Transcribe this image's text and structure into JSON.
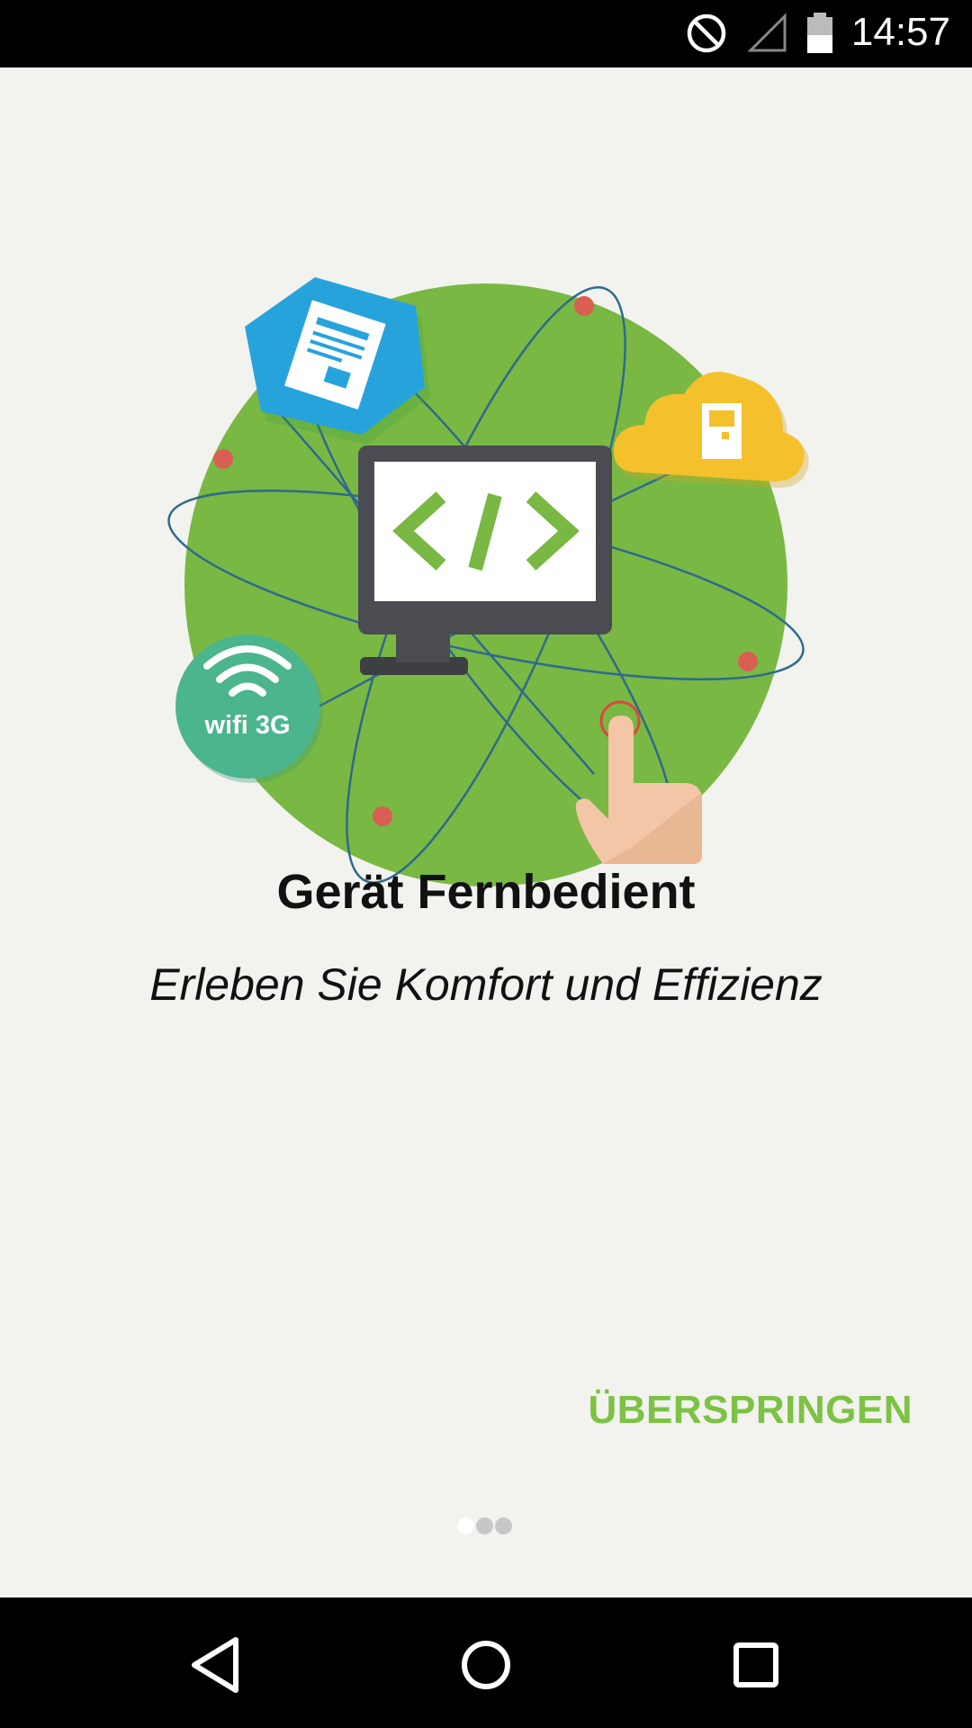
{
  "status_bar": {
    "time": "14:57",
    "icons": [
      "do-not-disturb-icon",
      "signal-icon",
      "battery-icon"
    ]
  },
  "onboarding": {
    "illustration": {
      "icons": [
        "monitor-code-icon",
        "document-hexagon-icon",
        "cloud-device-icon",
        "wifi-3g-icon",
        "tap-hand-icon"
      ],
      "wifi_badge_text": "wifi 3G"
    },
    "title": "Gerät Fernbedient",
    "subtitle": "Erleben Sie Komfort und Effizienz",
    "skip_label": "ÜBERSPRINGEN",
    "page_indicator": {
      "current": 1,
      "total": 3
    }
  },
  "nav_bar": {
    "icons": [
      "back-icon",
      "home-icon",
      "recents-icon"
    ]
  },
  "colors": {
    "accent": "#7cc244",
    "globe": "#79b843",
    "background": "#f2f2ef"
  }
}
